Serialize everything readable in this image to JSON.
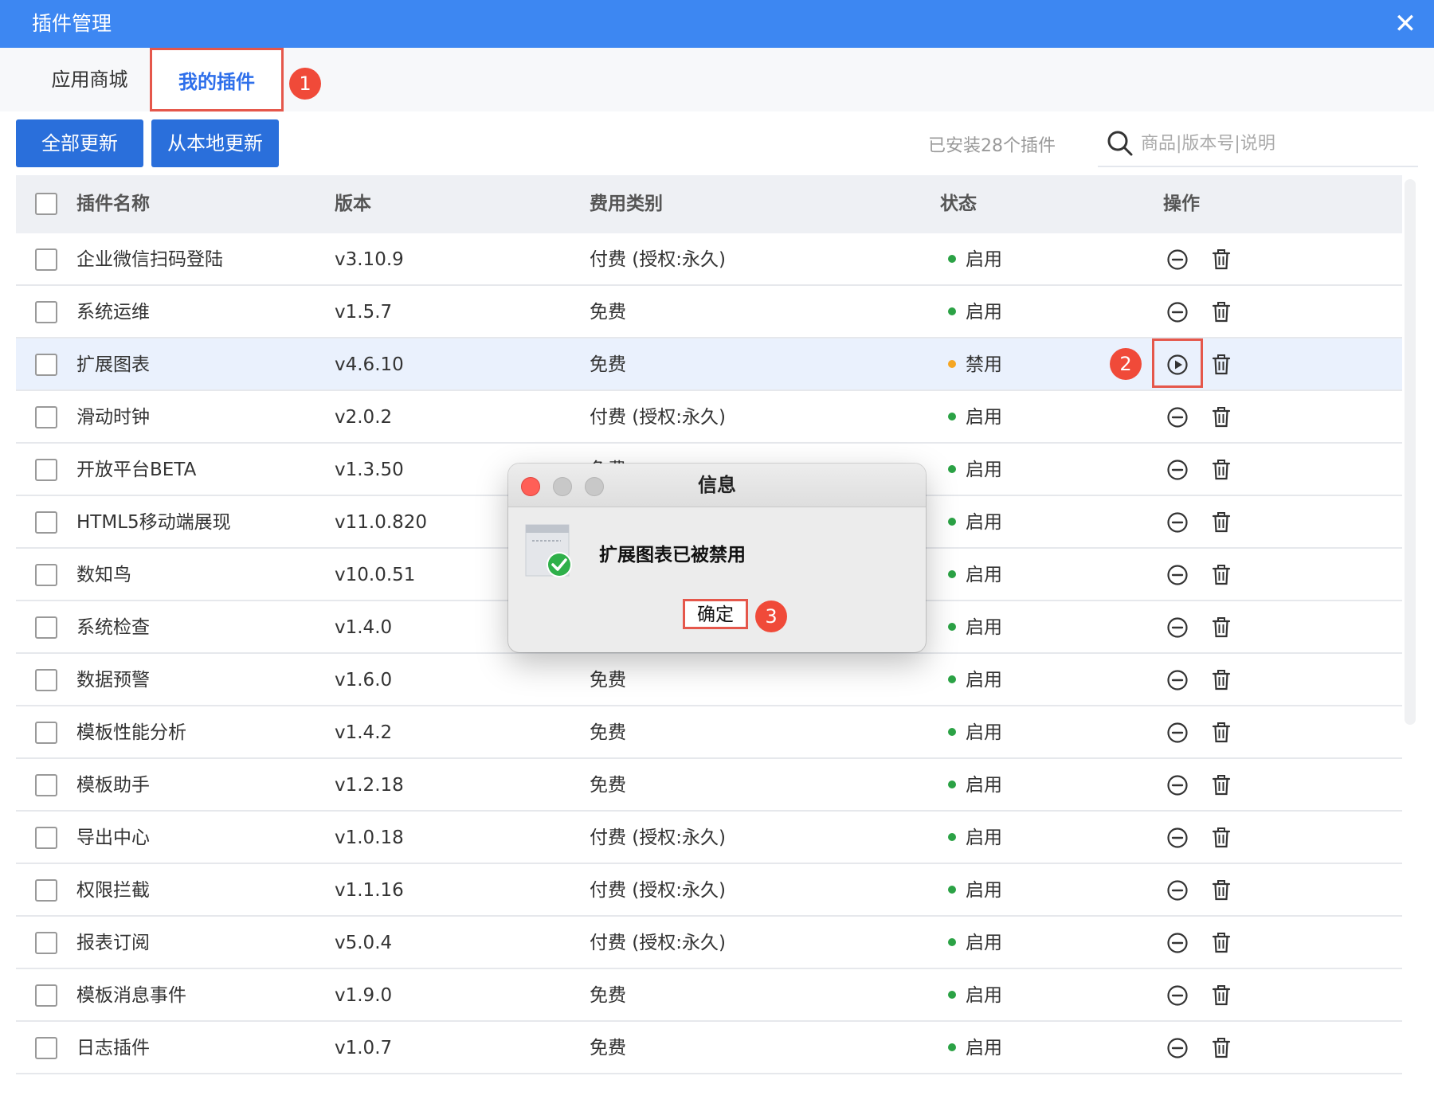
{
  "window": {
    "title": "插件管理",
    "close_icon": "close-icon"
  },
  "tabs": [
    {
      "label": "应用商城",
      "active": false
    },
    {
      "label": "我的插件",
      "active": true
    }
  ],
  "annotations": {
    "step1": "1",
    "step2": "2",
    "step3": "3",
    "color": "#F04A39"
  },
  "toolbar": {
    "update_all_label": "全部更新",
    "update_local_label": "从本地更新",
    "installed_text": "已安装28个插件",
    "search_placeholder": "商品|版本号|说明"
  },
  "table": {
    "headers": {
      "name": "插件名称",
      "version": "版本",
      "fee": "费用类别",
      "status": "状态",
      "actions": "操作"
    },
    "status_colors": {
      "enabled": "#2BA245",
      "disabled": "#F5A623"
    },
    "rows": [
      {
        "name": " 企业微信扫码登陆",
        "version": "v3.10.9",
        "fee": "付费 (授权:永久)",
        "status": "启用",
        "state": "enabled"
      },
      {
        "name": "系统运维",
        "version": "v1.5.7",
        "fee": "免费",
        "status": "启用",
        "state": "enabled"
      },
      {
        "name": "扩展图表",
        "version": "v4.6.10",
        "fee": "免费",
        "status": "禁用",
        "state": "disabled"
      },
      {
        "name": "滑动时钟",
        "version": "v2.0.2",
        "fee": "付费 (授权:永久)",
        "status": "启用",
        "state": "enabled"
      },
      {
        "name": " 开放平台BETA",
        "version": "v1.3.50",
        "fee": "免费",
        "status": "启用",
        "state": "enabled"
      },
      {
        "name": "HTML5移动端展现",
        "version": "v11.0.820",
        "fee": "",
        "status": "启用",
        "state": "enabled"
      },
      {
        "name": "数知鸟",
        "version": "v10.0.51",
        "fee": "",
        "status": "启用",
        "state": "enabled"
      },
      {
        "name": "系统检查",
        "version": "v1.4.0",
        "fee": "",
        "status": "启用",
        "state": "enabled"
      },
      {
        "name": "数据预警",
        "version": "v1.6.0",
        "fee": "免费",
        "status": "启用",
        "state": "enabled"
      },
      {
        "name": "模板性能分析",
        "version": "v1.4.2",
        "fee": "免费",
        "status": "启用",
        "state": "enabled"
      },
      {
        "name": "模板助手",
        "version": "v1.2.18",
        "fee": "免费",
        "status": "启用",
        "state": "enabled"
      },
      {
        "name": "导出中心",
        "version": "v1.0.18",
        "fee": "付费 (授权:永久)",
        "status": "启用",
        "state": "enabled"
      },
      {
        "name": "权限拦截",
        "version": "v1.1.16",
        "fee": "付费 (授权:永久)",
        "status": "启用",
        "state": "enabled"
      },
      {
        "name": "报表订阅",
        "version": "v5.0.4",
        "fee": "付费 (授权:永久)",
        "status": "启用",
        "state": "enabled"
      },
      {
        "name": "模板消息事件",
        "version": "v1.9.0",
        "fee": "免费",
        "status": "启用",
        "state": "enabled"
      },
      {
        "name": "日志插件",
        "version": "v1.0.7",
        "fee": "免费",
        "status": "启用",
        "state": "enabled"
      }
    ]
  },
  "dialog": {
    "title": "信息",
    "message": "扩展图表已被禁用",
    "ok_label": "确定",
    "traffic_lights": {
      "close": "#FF5F57",
      "minimize": "#C8C8C8",
      "zoom": "#C8C8C8"
    }
  }
}
